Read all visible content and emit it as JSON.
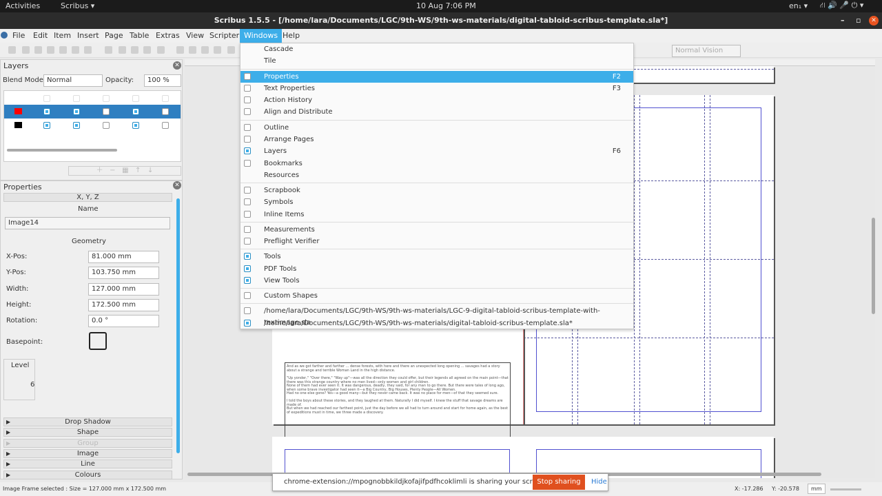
{
  "topbar": {
    "activities": "Activities",
    "app": "Scribus ▾",
    "clock": "10 Aug  7:06 PM",
    "lang": "en₁ ▾"
  },
  "window": {
    "title": "Scribus 1.5.5 - [/home/lara/Documents/LGC/9th-WS/9th-ws-materials/digital-tabloid-scribus-template.sla*]"
  },
  "menubar": [
    "File",
    "Edit",
    "Item",
    "Insert",
    "Page",
    "Table",
    "Extras",
    "View",
    "Scripter",
    "Windows",
    "Help"
  ],
  "toolbar": {
    "vision": "Normal Vision"
  },
  "layers": {
    "title": "Layers",
    "blend_label": "Blend Mode:",
    "blend_value": "Normal",
    "opacity_label": "Opacity:",
    "opacity_value": "100 %",
    "rows": [
      {
        "color": "#ff0000",
        "checks": [
          true,
          true,
          false,
          true,
          false
        ],
        "selected": true
      },
      {
        "color": "#000000",
        "checks": [
          true,
          true,
          false,
          true,
          false
        ],
        "selected": false
      }
    ]
  },
  "properties": {
    "title": "Properties",
    "section_xyz": "X, Y, Z",
    "name_label": "Name",
    "name_value": "Image14",
    "geometry_label": "Geometry",
    "fields": [
      {
        "label": "X-Pos:",
        "value": "81.000 mm"
      },
      {
        "label": "Y-Pos:",
        "value": "103.750 mm"
      },
      {
        "label": "Width:",
        "value": "127.000 mm"
      },
      {
        "label": "Height:",
        "value": "172.500 mm"
      },
      {
        "label": "Rotation:",
        "value": "0.0 °"
      }
    ],
    "basepoint_label": "Basepoint:",
    "level_label": "Level",
    "level_value": "6",
    "sections": [
      "Drop Shadow",
      "Shape",
      "Group",
      "Image",
      "Line",
      "Colours"
    ]
  },
  "windows_menu": [
    {
      "label": "Cascade",
      "check": null
    },
    {
      "label": "Tile",
      "check": null
    },
    {
      "sep": true
    },
    {
      "label": "Properties",
      "check": false,
      "key": "F2",
      "selected": true
    },
    {
      "label": "Text Properties",
      "check": false,
      "key": "F3"
    },
    {
      "label": "Action History",
      "check": false
    },
    {
      "label": "Align and Distribute",
      "check": false
    },
    {
      "sep": true
    },
    {
      "label": "Outline",
      "check": false
    },
    {
      "label": "Arrange Pages",
      "check": false
    },
    {
      "label": "Layers",
      "check": true,
      "key": "F6"
    },
    {
      "label": "Bookmarks",
      "check": false
    },
    {
      "label": "Resources",
      "check": null
    },
    {
      "sep": true
    },
    {
      "label": "Scrapbook",
      "check": false
    },
    {
      "label": "Symbols",
      "check": false
    },
    {
      "label": "Inline Items",
      "check": false
    },
    {
      "sep": true
    },
    {
      "label": "Measurements",
      "check": false
    },
    {
      "label": "Preflight Verifier",
      "check": false
    },
    {
      "sep": true
    },
    {
      "label": "Tools",
      "check": true
    },
    {
      "label": "PDF Tools",
      "check": true
    },
    {
      "label": "View Tools",
      "check": true
    },
    {
      "sep": true
    },
    {
      "label": "Custom Shapes",
      "check": false
    },
    {
      "sep": true
    },
    {
      "label": "/home/lara/Documents/LGC/9th-WS/9th-ws-materials/LGC-9-digital-tabloid-scribus-template-with-textimage.sla",
      "check": false
    },
    {
      "label": "/home/lara/Documents/LGC/9th-WS/9th-ws-materials/digital-tabloid-scribus-template.sla*",
      "check": true
    }
  ],
  "document_text": [
    "And as we got farther and farther ... dense forests, with here and there an unexpected long opening ... savages had a story about a strange and terrible Woman Land in the high distance.",
    "\"Up yonder,\" \"Over there,\" \"Way up\"—was all the direction they could offer, but their legends all agreed on the main point—that there was this strange country where no men lived—only women and girl children.",
    "None of them had ever seen it. It was dangerous, deadly, they said, for any man to go there. But there were tales of long ago, when some brave investigator had seen it—a Big Country, Big Houses, Plenty People—All Women.",
    "Had no one else gone? Yes—a good many—but they never came back. It was no place for men—of that they seemed sure.",
    "I told the boys about these stories, and they laughed at them. Naturally I did myself. I knew the stuff that savage dreams are made of.",
    "But when we had reached our farthest point, just the day before we all had to turn around and start for home again, as the best of expeditions must in time, we three made a discovery."
  ],
  "status": {
    "text": "Image Frame selected : Size = 127.000 mm x 172.500 mm",
    "x": "X: -17.286",
    "y": "Y: -20.578",
    "unit": "mm"
  },
  "share": {
    "text": "chrome-extension://mpognobbkildjkofajifpdfhcoklimli is sharing your screen.",
    "stop": "Stop sharing",
    "hide": "Hide"
  },
  "colors": {
    "accent": "#3daee9",
    "stop": "#e0501f"
  }
}
